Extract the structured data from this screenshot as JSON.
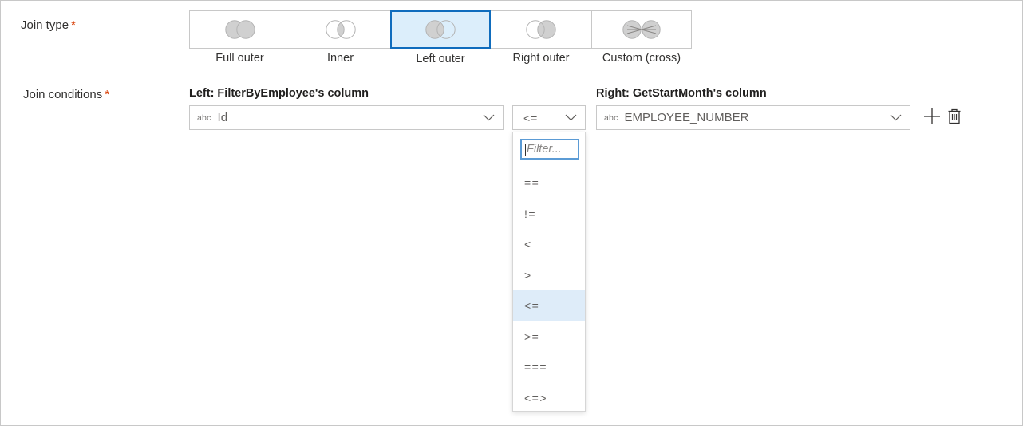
{
  "form": {
    "join_type_label": "Join type",
    "join_conditions_label": "Join conditions",
    "required_marker": "*"
  },
  "join_type": {
    "selected": "Left outer",
    "options": [
      {
        "label": "Full outer",
        "icon": "venn-full-outer-icon",
        "selected": false
      },
      {
        "label": "Inner",
        "icon": "venn-inner-icon",
        "selected": false
      },
      {
        "label": "Left outer",
        "icon": "venn-left-outer-icon",
        "selected": true
      },
      {
        "label": "Right outer",
        "icon": "venn-right-outer-icon",
        "selected": false
      },
      {
        "label": "Custom (cross)",
        "icon": "venn-custom-cross-icon",
        "selected": false
      }
    ]
  },
  "join_conditions": {
    "left": {
      "header": "Left: FilterByEmployee's column",
      "type_badge": "abc",
      "value": "Id",
      "chevron_icon": "chevron-down-icon"
    },
    "operator": {
      "value": "<=",
      "chevron_icon": "chevron-down-icon",
      "dropdown_open": true,
      "filter_placeholder": "Filter...",
      "filter_value": "",
      "options": [
        {
          "label": "==",
          "selected": false
        },
        {
          "label": "!=",
          "selected": false
        },
        {
          "label": "<",
          "selected": false
        },
        {
          "label": ">",
          "selected": false
        },
        {
          "label": "<=",
          "selected": true
        },
        {
          "label": ">=",
          "selected": false
        },
        {
          "label": "===",
          "selected": false
        },
        {
          "label": "<=>",
          "selected": false
        }
      ]
    },
    "right": {
      "header": "Right: GetStartMonth's column",
      "type_badge": "abc",
      "value": "EMPLOYEE_NUMBER",
      "chevron_icon": "chevron-down-icon"
    },
    "actions": {
      "add_icon": "plus-icon",
      "delete_icon": "trash-icon"
    }
  },
  "colors": {
    "accent": "#0f6cbd",
    "selected_tile_bg": "#dceefb",
    "option_highlight_bg": "#deecf9",
    "required_star": "#d83b01",
    "border": "#c8c8c8",
    "venn_fill": "#d0d0d0",
    "venn_stroke": "#b3b3b3"
  }
}
